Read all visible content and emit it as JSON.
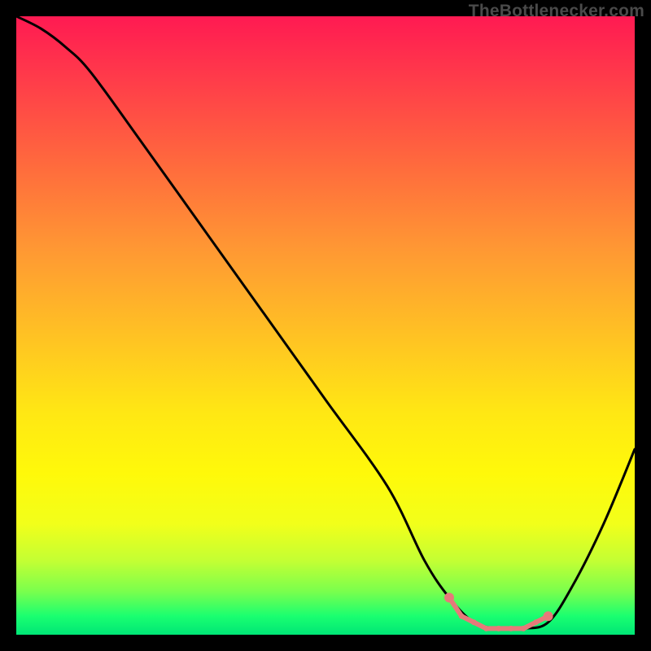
{
  "watermark": "TheBottlenecker.com",
  "chart_data": {
    "type": "line",
    "title": "",
    "xlabel": "",
    "ylabel": "",
    "xlim": [
      0,
      100
    ],
    "ylim": [
      0,
      100
    ],
    "series": [
      {
        "name": "bottleneck-curve",
        "x": [
          0,
          4,
          8,
          12,
          20,
          30,
          40,
          50,
          60,
          66,
          70,
          74,
          78,
          82,
          86,
          90,
          95,
          100
        ],
        "y": [
          100,
          98,
          95,
          91,
          80,
          66,
          52,
          38,
          24,
          12,
          6,
          2,
          1,
          1,
          2,
          8,
          18,
          30
        ]
      }
    ],
    "markers": {
      "name": "optimal-range",
      "x": [
        70,
        72,
        74,
        76,
        78,
        80,
        82,
        84,
        86
      ],
      "y": [
        6,
        3,
        2,
        1,
        1,
        1,
        1,
        2,
        3
      ]
    },
    "gradient_meaning": "vertical color gradient from red (high bottleneck) at top to green (no bottleneck) at bottom"
  }
}
